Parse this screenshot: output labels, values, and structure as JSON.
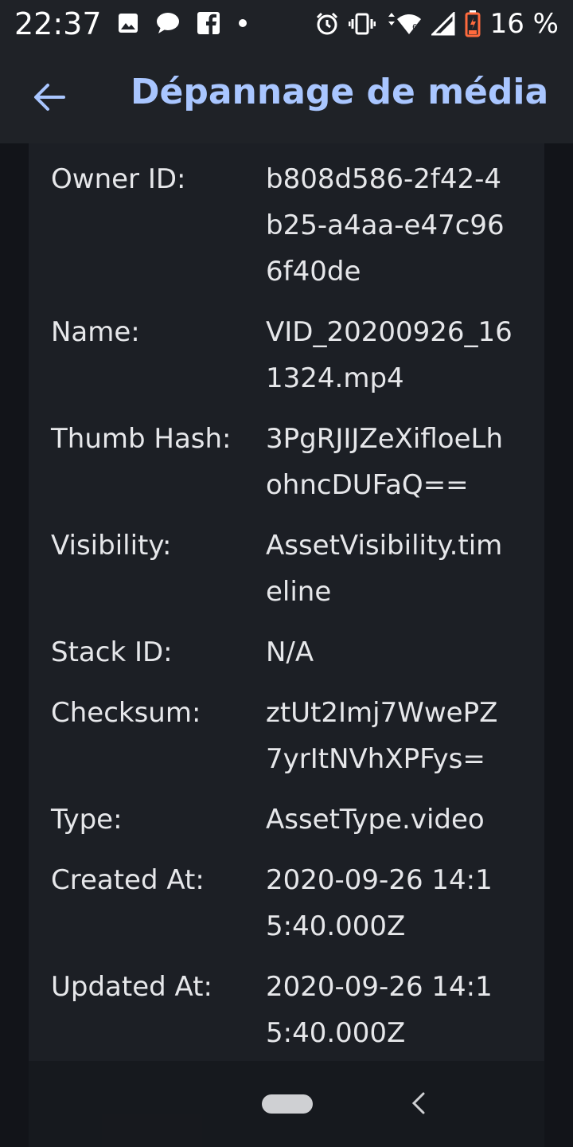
{
  "status_bar": {
    "time": "22:37",
    "battery_pct": "16 %",
    "icons_left": [
      "image-icon",
      "chat-bubble-icon",
      "facebook-icon",
      "dot-icon"
    ],
    "icons_right": [
      "alarm-icon",
      "vibrate-icon",
      "wifi-icon",
      "cell-signal-icon",
      "battery-icon"
    ]
  },
  "app_bar": {
    "title": "Dépannage de média",
    "back_icon": "arrow-left-icon"
  },
  "details": [
    {
      "label": "Owner ID:",
      "value": "b808d586-2f42-4b25-a4aa-e47c966f40de"
    },
    {
      "label": "Name:",
      "value": "VID_20200926_161324.mp4"
    },
    {
      "label": "Thumb Hash:",
      "value": "3PgRJIJZeXifloeLhohncDUFaQ=="
    },
    {
      "label": "Visibility:",
      "value": "AssetVisibility.timeline"
    },
    {
      "label": "Stack ID:",
      "value": "N/A"
    },
    {
      "label": "Checksum:",
      "value": "ztUt2Imj7WwePZ7yrItNVhXPFys="
    },
    {
      "label": "Type:",
      "value": "AssetType.video"
    },
    {
      "label": "Created At:",
      "value": "2020-09-26 14:15:40.000Z"
    },
    {
      "label": "Updated At:",
      "value": "2020-09-26 14:15:40.000Z"
    }
  ],
  "colors": {
    "background": "#121419",
    "app_bar": "#1f2227",
    "panel": "#1c1f25",
    "title_accent": "#a9c6ff",
    "text": "#e6e7ea"
  }
}
